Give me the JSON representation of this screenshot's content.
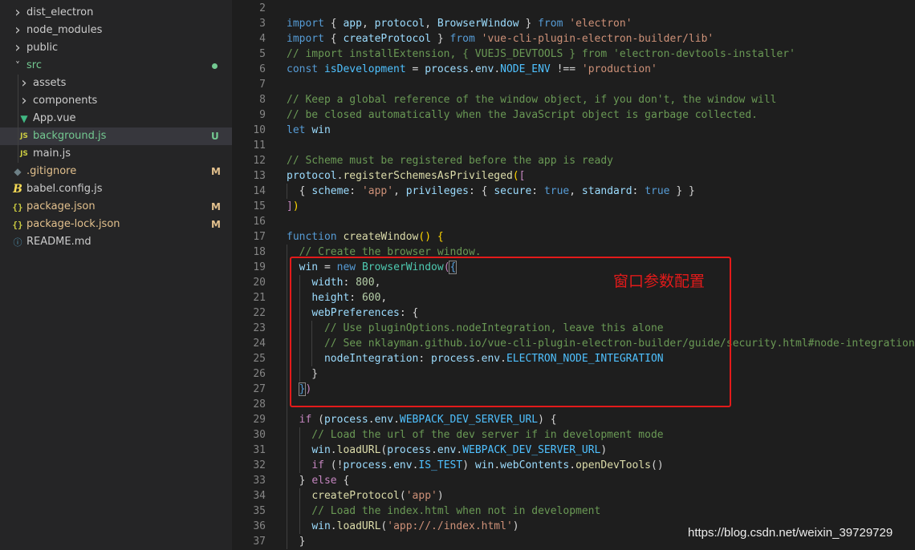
{
  "explorer": {
    "items": [
      {
        "label": "dist_electron",
        "kind": "folder",
        "expanded": false,
        "icon": "chevron-right-icon",
        "color": "#cccccc",
        "badge": ""
      },
      {
        "label": "node_modules",
        "kind": "folder",
        "expanded": false,
        "icon": "chevron-right-icon",
        "color": "#cccccc",
        "badge": ""
      },
      {
        "label": "public",
        "kind": "folder",
        "expanded": false,
        "icon": "chevron-right-icon",
        "color": "#cccccc",
        "badge": ""
      },
      {
        "label": "src",
        "kind": "folder",
        "expanded": true,
        "icon": "chevron-down-icon",
        "color": "#73c991",
        "badge": "dot"
      },
      {
        "label": "assets",
        "kind": "folder",
        "expanded": false,
        "icon": "chevron-right-icon",
        "color": "#cccccc",
        "badge": ""
      },
      {
        "label": "components",
        "kind": "folder",
        "expanded": false,
        "icon": "chevron-right-icon",
        "color": "#cccccc",
        "badge": ""
      },
      {
        "label": "App.vue",
        "kind": "file",
        "icon": "vue-file-icon",
        "color": "#cccccc",
        "badge": ""
      },
      {
        "label": "background.js",
        "kind": "file",
        "icon": "js-file-icon",
        "color": "#73c991",
        "badge": "U",
        "selected": true
      },
      {
        "label": "main.js",
        "kind": "file",
        "icon": "js-file-icon",
        "color": "#cccccc",
        "badge": ""
      },
      {
        "label": ".gitignore",
        "kind": "file",
        "icon": "git-file-icon",
        "color": "#e2c08d",
        "badge": "M"
      },
      {
        "label": "babel.config.js",
        "kind": "file",
        "icon": "babel-file-icon",
        "color": "#cccccc",
        "badge": ""
      },
      {
        "label": "package.json",
        "kind": "file",
        "icon": "json-file-icon",
        "color": "#e2c08d",
        "badge": "M"
      },
      {
        "label": "package-lock.json",
        "kind": "file",
        "icon": "json-file-icon",
        "color": "#e2c08d",
        "badge": "M"
      },
      {
        "label": "README.md",
        "kind": "file",
        "icon": "info-file-icon",
        "color": "#cccccc",
        "badge": ""
      }
    ],
    "badge_colors": {
      "U": "#73c991",
      "M": "#e2c08d",
      "dot": "#73c991"
    }
  },
  "editor": {
    "lines": [
      {
        "n": "2",
        "tokens": []
      },
      {
        "n": "3",
        "tokens": [
          [
            "kw",
            "import"
          ],
          [
            "pun",
            " { "
          ],
          [
            "var",
            "app"
          ],
          [
            "pun",
            ", "
          ],
          [
            "var",
            "protocol"
          ],
          [
            "pun",
            ", "
          ],
          [
            "var",
            "BrowserWindow"
          ],
          [
            "pun",
            " } "
          ],
          [
            "kw",
            "from"
          ],
          [
            "pun",
            " "
          ],
          [
            "str",
            "'electron'"
          ]
        ]
      },
      {
        "n": "4",
        "tokens": [
          [
            "kw",
            "import"
          ],
          [
            "pun",
            " { "
          ],
          [
            "var",
            "createProtocol"
          ],
          [
            "pun",
            " } "
          ],
          [
            "kw",
            "from"
          ],
          [
            "pun",
            " "
          ],
          [
            "str",
            "'vue-cli-plugin-electron-builder/lib'"
          ]
        ]
      },
      {
        "n": "5",
        "tokens": [
          [
            "com",
            "// import installExtension, { VUEJS_DEVTOOLS } from 'electron-devtools-installer'"
          ]
        ]
      },
      {
        "n": "6",
        "tokens": [
          [
            "kw",
            "const"
          ],
          [
            "pun",
            " "
          ],
          [
            "con",
            "isDevelopment"
          ],
          [
            "pun",
            " = "
          ],
          [
            "var",
            "process"
          ],
          [
            "pun",
            "."
          ],
          [
            "var",
            "env"
          ],
          [
            "pun",
            "."
          ],
          [
            "con",
            "NODE_ENV"
          ],
          [
            "pun",
            " !== "
          ],
          [
            "str",
            "'production'"
          ]
        ]
      },
      {
        "n": "7",
        "tokens": []
      },
      {
        "n": "8",
        "tokens": [
          [
            "com",
            "// Keep a global reference of the window object, if you don't, the window will"
          ]
        ]
      },
      {
        "n": "9",
        "tokens": [
          [
            "com",
            "// be closed automatically when the JavaScript object is garbage collected."
          ]
        ]
      },
      {
        "n": "10",
        "tokens": [
          [
            "kw",
            "let"
          ],
          [
            "pun",
            " "
          ],
          [
            "var",
            "win"
          ]
        ]
      },
      {
        "n": "11",
        "tokens": []
      },
      {
        "n": "12",
        "tokens": [
          [
            "com",
            "// Scheme must be registered before the app is ready"
          ]
        ]
      },
      {
        "n": "13",
        "tokens": [
          [
            "var",
            "protocol"
          ],
          [
            "pun",
            "."
          ],
          [
            "fn",
            "registerSchemesAsPrivileged"
          ],
          [
            "br",
            "("
          ],
          [
            "ctl",
            "["
          ]
        ]
      },
      {
        "n": "14",
        "tokens": [
          [
            "pun",
            "  { "
          ],
          [
            "var",
            "scheme"
          ],
          [
            "pun",
            ": "
          ],
          [
            "str",
            "'app'"
          ],
          [
            "pun",
            ", "
          ],
          [
            "var",
            "privileges"
          ],
          [
            "pun",
            ": { "
          ],
          [
            "var",
            "secure"
          ],
          [
            "pun",
            ": "
          ],
          [
            "kw",
            "true"
          ],
          [
            "pun",
            ", "
          ],
          [
            "var",
            "standard"
          ],
          [
            "pun",
            ": "
          ],
          [
            "kw",
            "true"
          ],
          [
            "pun",
            " } }"
          ]
        ]
      },
      {
        "n": "15",
        "tokens": [
          [
            "ctl",
            "]"
          ],
          [
            "br",
            ")"
          ]
        ]
      },
      {
        "n": "16",
        "tokens": []
      },
      {
        "n": "17",
        "tokens": [
          [
            "kw",
            "function"
          ],
          [
            "pun",
            " "
          ],
          [
            "fn",
            "createWindow"
          ],
          [
            "br",
            "()"
          ],
          [
            "pun",
            " "
          ],
          [
            "br",
            "{"
          ]
        ]
      },
      {
        "n": "18",
        "tokens": [
          [
            "com",
            "  // Create the browser window."
          ]
        ]
      },
      {
        "n": "19",
        "tokens": [
          [
            "pun",
            "  "
          ],
          [
            "var",
            "win"
          ],
          [
            "pun",
            " = "
          ],
          [
            "kw",
            "new"
          ],
          [
            "pun",
            " "
          ],
          [
            "cls",
            "BrowserWindow"
          ],
          [
            "ctl",
            "("
          ],
          [
            "kw",
            "{"
          ]
        ]
      },
      {
        "n": "20",
        "tokens": [
          [
            "pun",
            "    "
          ],
          [
            "var",
            "width"
          ],
          [
            "pun",
            ": "
          ],
          [
            "num",
            "800"
          ],
          [
            "pun",
            ","
          ]
        ]
      },
      {
        "n": "21",
        "tokens": [
          [
            "pun",
            "    "
          ],
          [
            "var",
            "height"
          ],
          [
            "pun",
            ": "
          ],
          [
            "num",
            "600"
          ],
          [
            "pun",
            ","
          ]
        ]
      },
      {
        "n": "22",
        "tokens": [
          [
            "pun",
            "    "
          ],
          [
            "var",
            "webPreferences"
          ],
          [
            "pun",
            ": {"
          ]
        ]
      },
      {
        "n": "23",
        "tokens": [
          [
            "com",
            "      // Use pluginOptions.nodeIntegration, leave this alone"
          ]
        ]
      },
      {
        "n": "24",
        "tokens": [
          [
            "com",
            "      // See nklayman.github.io/vue-cli-plugin-electron-builder/guide/security.html#node-integration f"
          ]
        ]
      },
      {
        "n": "25",
        "tokens": [
          [
            "pun",
            "      "
          ],
          [
            "var",
            "nodeIntegration"
          ],
          [
            "pun",
            ": "
          ],
          [
            "var",
            "process"
          ],
          [
            "pun",
            "."
          ],
          [
            "var",
            "env"
          ],
          [
            "pun",
            "."
          ],
          [
            "con",
            "ELECTRON_NODE_INTEGRATION"
          ]
        ]
      },
      {
        "n": "26",
        "tokens": [
          [
            "pun",
            "    }"
          ]
        ]
      },
      {
        "n": "27",
        "tokens": [
          [
            "pun",
            "  "
          ],
          [
            "kw",
            "}"
          ],
          [
            "ctl",
            ")"
          ]
        ]
      },
      {
        "n": "28",
        "tokens": []
      },
      {
        "n": "29",
        "tokens": [
          [
            "pun",
            "  "
          ],
          [
            "ctl",
            "if"
          ],
          [
            "pun",
            " ("
          ],
          [
            "var",
            "process"
          ],
          [
            "pun",
            "."
          ],
          [
            "var",
            "env"
          ],
          [
            "pun",
            "."
          ],
          [
            "con",
            "WEBPACK_DEV_SERVER_URL"
          ],
          [
            "pun",
            ") {"
          ]
        ]
      },
      {
        "n": "30",
        "tokens": [
          [
            "com",
            "    // Load the url of the dev server if in development mode"
          ]
        ]
      },
      {
        "n": "31",
        "tokens": [
          [
            "pun",
            "    "
          ],
          [
            "var",
            "win"
          ],
          [
            "pun",
            "."
          ],
          [
            "fn",
            "loadURL"
          ],
          [
            "pun",
            "("
          ],
          [
            "var",
            "process"
          ],
          [
            "pun",
            "."
          ],
          [
            "var",
            "env"
          ],
          [
            "pun",
            "."
          ],
          [
            "con",
            "WEBPACK_DEV_SERVER_URL"
          ],
          [
            "pun",
            ")"
          ]
        ]
      },
      {
        "n": "32",
        "tokens": [
          [
            "pun",
            "    "
          ],
          [
            "ctl",
            "if"
          ],
          [
            "pun",
            " (!"
          ],
          [
            "var",
            "process"
          ],
          [
            "pun",
            "."
          ],
          [
            "var",
            "env"
          ],
          [
            "pun",
            "."
          ],
          [
            "con",
            "IS_TEST"
          ],
          [
            "pun",
            ") "
          ],
          [
            "var",
            "win"
          ],
          [
            "pun",
            "."
          ],
          [
            "var",
            "webContents"
          ],
          [
            "pun",
            "."
          ],
          [
            "fn",
            "openDevTools"
          ],
          [
            "pun",
            "()"
          ]
        ]
      },
      {
        "n": "33",
        "tokens": [
          [
            "pun",
            "  } "
          ],
          [
            "ctl",
            "else"
          ],
          [
            "pun",
            " {"
          ]
        ]
      },
      {
        "n": "34",
        "tokens": [
          [
            "pun",
            "    "
          ],
          [
            "fn",
            "createProtocol"
          ],
          [
            "pun",
            "("
          ],
          [
            "str",
            "'app'"
          ],
          [
            "pun",
            ")"
          ]
        ]
      },
      {
        "n": "35",
        "tokens": [
          [
            "com",
            "    // Load the index.html when not in development"
          ]
        ]
      },
      {
        "n": "36",
        "tokens": [
          [
            "pun",
            "    "
          ],
          [
            "var",
            "win"
          ],
          [
            "pun",
            "."
          ],
          [
            "fn",
            "loadURL"
          ],
          [
            "pun",
            "("
          ],
          [
            "str",
            "'app://./index.html'"
          ],
          [
            "pun",
            ")"
          ]
        ]
      },
      {
        "n": "37",
        "tokens": [
          [
            "pun",
            "  }"
          ]
        ]
      }
    ]
  },
  "annotation": {
    "text": "窗口参数配置",
    "color": "#e31a1a"
  },
  "watermark": {
    "text": "https://blog.csdn.net/weixin_39729729"
  }
}
